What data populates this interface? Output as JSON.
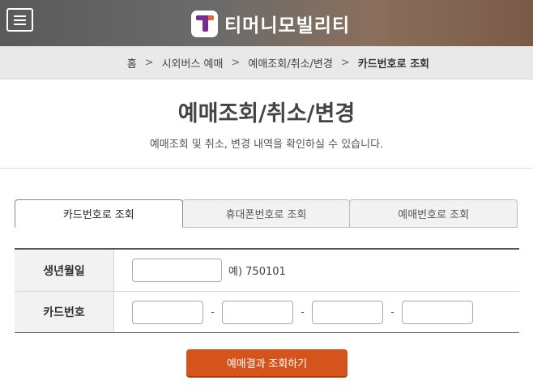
{
  "header": {
    "brand": "티머니모빌리티",
    "menu_icon": "hamburger-menu-icon",
    "logo_icon": "tmoney-t-logo-icon",
    "colors": {
      "logo_purple": "#7b2a8f",
      "logo_orange": "#e8632a"
    }
  },
  "breadcrumb": {
    "items": [
      "홈",
      "시외버스 예매",
      "예매조회/취소/변경"
    ],
    "current": "카드번호로 조회",
    "separator": ">"
  },
  "page": {
    "title": "예매조회/취소/변경",
    "subtitle": "예매조회 및 취소, 변경 내역을 확인하실 수 있습니다."
  },
  "tabs": [
    {
      "label": "카드번호로 조회",
      "active": true
    },
    {
      "label": "휴대폰번호로 조회",
      "active": false
    },
    {
      "label": "예매번호로 조회",
      "active": false
    }
  ],
  "form": {
    "birth_label": "생년월일",
    "birth_value": "",
    "birth_hint": "예) 750101",
    "card_label": "카드번호",
    "card_values": [
      "",
      "",
      "",
      ""
    ],
    "dash": "-"
  },
  "submit": {
    "label": "예매결과 조회하기",
    "color": "#d4541b"
  }
}
